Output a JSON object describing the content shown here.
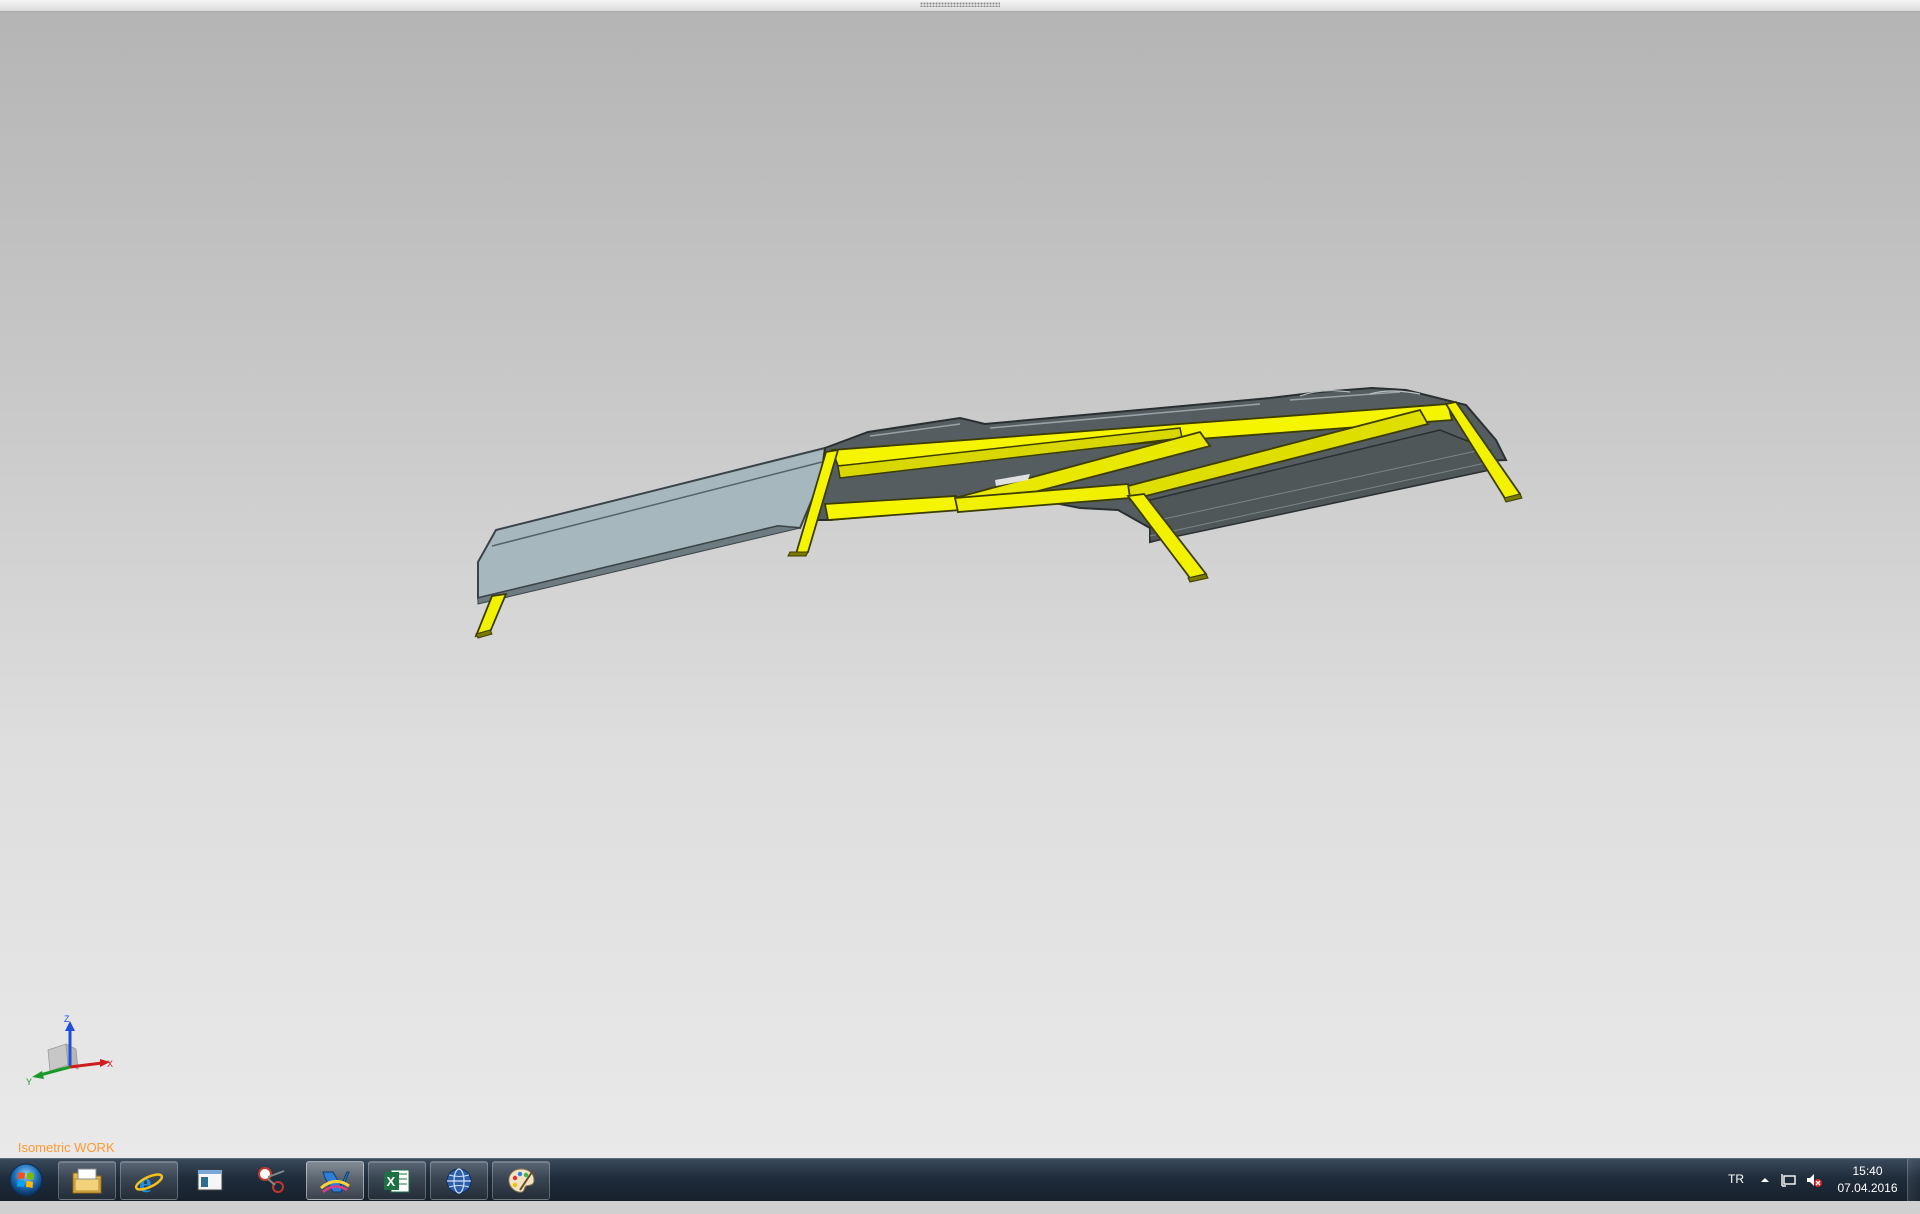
{
  "viewport": {
    "view_label": "   Isometric WORK",
    "triad": {
      "x_label": "X",
      "y_label": "Y",
      "z_label": "Z"
    },
    "model": {
      "name": "spoiler-with-frame",
      "frame_color": "#f2f200",
      "panel_color": "#9fb0b6",
      "dark_panel_color": "#4e5659"
    }
  },
  "taskbar": {
    "start_icon": "windows-orb-icon",
    "tasks": [
      {
        "name": "explorer",
        "icon": "folder-icon"
      },
      {
        "name": "internet-explorer",
        "icon": "internet-explorer-icon"
      },
      {
        "name": "window-app",
        "icon": "window-icon"
      },
      {
        "name": "snipping-tool",
        "icon": "scissors-icon"
      },
      {
        "name": "nx-cad",
        "icon": "nx-icon"
      },
      {
        "name": "excel",
        "icon": "excel-icon"
      },
      {
        "name": "browser",
        "icon": "globe-icon"
      },
      {
        "name": "paint",
        "icon": "palette-icon"
      }
    ],
    "tray": {
      "language": "TR",
      "time": "15:40",
      "date": "07.04.2016"
    }
  }
}
